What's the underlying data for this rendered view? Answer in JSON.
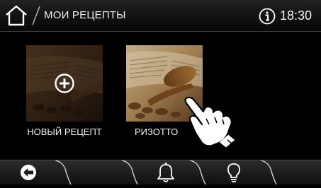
{
  "header": {
    "title": "МОИ РЕЦЕПТЫ",
    "time": "18:30",
    "home_icon": "home-icon",
    "info_icon": "info-icon"
  },
  "recipes": [
    {
      "label": "НОВЫЙ РЕЦЕПТ",
      "icon": "plus-icon"
    },
    {
      "label": "РИЗОТТО"
    }
  ],
  "gesture_icon": "pointing-hand-icon",
  "footer": {
    "buttons": [
      "back-icon",
      "bell-icon",
      "lightbulb-icon"
    ]
  },
  "colors": {
    "background": "#000000",
    "text": "#f2f2f2",
    "bar": "#1a1a1a"
  }
}
